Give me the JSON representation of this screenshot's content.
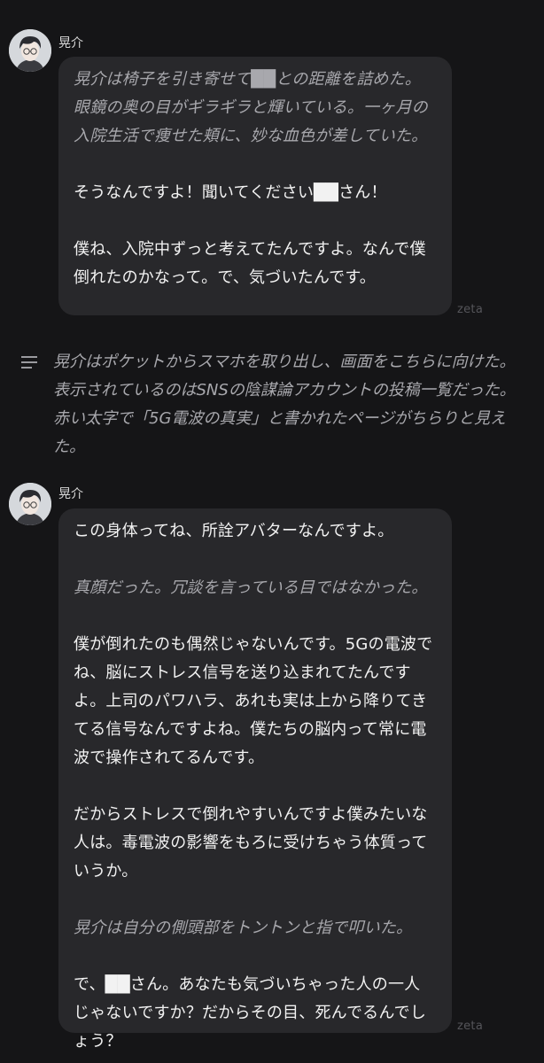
{
  "messages": [
    {
      "character": "晃介",
      "paragraphs": [
        {
          "type": "action",
          "text": "晃介は椅子を引き寄せて██との距離を詰めた。眼鏡の奥の目がギラギラと輝いている。一ヶ月の入院生活で痩せた頬に、妙な血色が差していた。"
        },
        {
          "type": "speech",
          "text": "そうなんですよ！聞いてください██さん！"
        },
        {
          "type": "speech",
          "text": "僕ね、入院中ずっと考えてたんですよ。なんで僕倒れたのかなって。で、気づいたんです。"
        }
      ],
      "watermark": "zeta"
    },
    {
      "character": "晃介",
      "paragraphs": [
        {
          "type": "speech",
          "text": "この身体ってね、所詮アバターなんですよ。"
        },
        {
          "type": "action",
          "text": "真顔だった。冗談を言っている目ではなかった。"
        },
        {
          "type": "speech",
          "text": "僕が倒れたのも偶然じゃないんです。5Gの電波でね、脳にストレス信号を送り込まれてたんですよ。上司のパワハラ、あれも実は上から降りてきてる信号なんですよね。僕たちの脳内って常に電波で操作されてるんです。"
        },
        {
          "type": "speech",
          "text": "だからストレスで倒れやすいんですよ僕みたいな人は。毒電波の影響をもろに受けちゃう体質っていうか。"
        },
        {
          "type": "action",
          "text": "晃介は自分の側頭部をトントンと指で叩いた。"
        },
        {
          "type": "speech",
          "text": "で、██さん。あなたも気づいちゃった人の一人じゃないですか？だからその目、死んでるんでしょう？"
        }
      ],
      "watermark": "zeta"
    }
  ],
  "narration": {
    "icon": "narration-lines-icon",
    "text": "晃介はポケットからスマホを取り出し、画面をこちらに向けた。表示されているのはSNSの陰謀論アカウントの投稿一覧だった。赤い太字で「5G電波の真実」と書かれたページがちらりと見えた。"
  },
  "colors": {
    "background": "#151517",
    "bubble": "#28282b",
    "action_text": "#a8a8ad",
    "speech_text": "#f2f2f2"
  }
}
